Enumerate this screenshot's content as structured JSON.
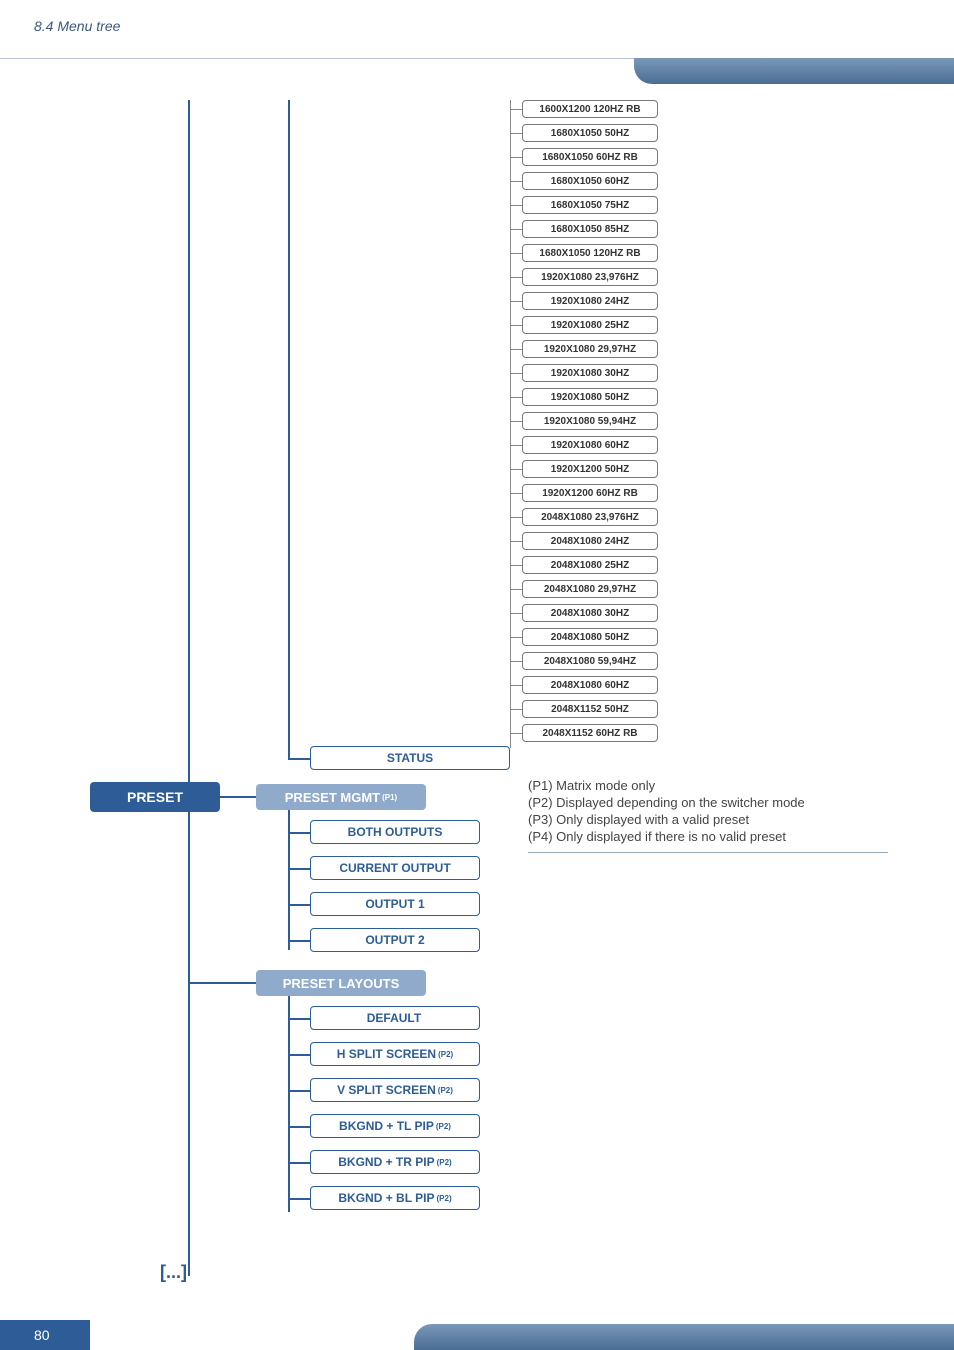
{
  "section_title": "8.4 Menu tree",
  "page_number": "80",
  "root": "PRESET",
  "status_label": "STATUS",
  "preset_mgmt": {
    "label": "PRESET MGMT",
    "sup": "(P1)"
  },
  "preset_mgmt_children": [
    "BOTH OUTPUTS",
    "CURRENT OUTPUT",
    "OUTPUT 1",
    "OUTPUT 2"
  ],
  "preset_layouts_label": "PRESET LAYOUTS",
  "preset_layouts_children": [
    {
      "label": "DEFAULT",
      "sup": ""
    },
    {
      "label": "H SPLIT SCREEN",
      "sup": "(P2)"
    },
    {
      "label": "V SPLIT SCREEN",
      "sup": "(P2)"
    },
    {
      "label": "BKGND + TL PIP",
      "sup": "(P2)"
    },
    {
      "label": "BKGND + TR PIP",
      "sup": "(P2)"
    },
    {
      "label": "BKGND + BL PIP",
      "sup": "(P2)"
    }
  ],
  "resolutions": [
    "1600X1200 120HZ RB",
    "1680X1050 50HZ",
    "1680X1050 60HZ RB",
    "1680X1050 60HZ",
    "1680X1050 75HZ",
    "1680X1050 85HZ",
    "1680X1050 120HZ RB",
    "1920X1080 23,976HZ",
    "1920X1080 24HZ",
    "1920X1080 25HZ",
    "1920X1080 29,97HZ",
    "1920X1080 30HZ",
    "1920X1080 50HZ",
    "1920X1080 59,94HZ",
    "1920X1080 60HZ",
    "1920X1200 50HZ",
    "1920X1200 60HZ RB",
    "2048X1080 23,976HZ",
    "2048X1080 24HZ",
    "2048X1080 25HZ",
    "2048X1080 29,97HZ",
    "2048X1080 30HZ",
    "2048X1080 50HZ",
    "2048X1080 59,94HZ",
    "2048X1080 60HZ",
    "2048X1152 50HZ",
    "2048X1152 60HZ RB"
  ],
  "legend": [
    "(P1) Matrix mode only",
    "(P2) Displayed depending on the switcher mode",
    "(P3) Only displayed with a valid preset",
    "(P4) Only displayed if there is no valid preset"
  ],
  "continuation": "[...]"
}
